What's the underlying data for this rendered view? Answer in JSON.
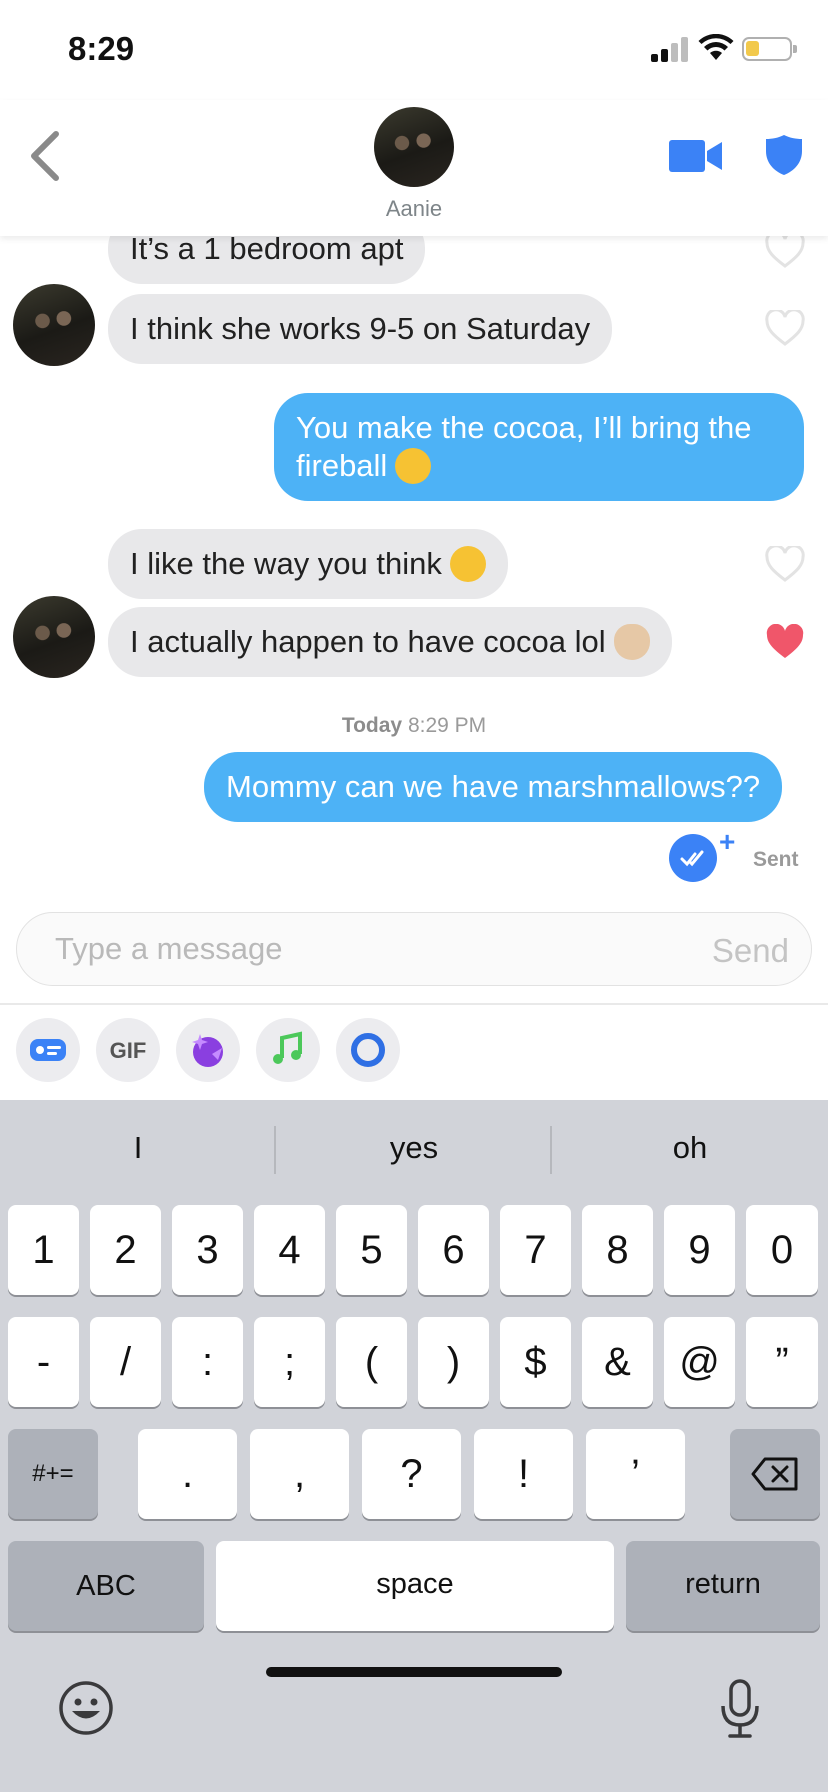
{
  "status_bar": {
    "time": "8:29",
    "battery_color": "#f2c94c"
  },
  "header": {
    "contact_name": "Aanie",
    "back_icon": "chevron-left-icon",
    "video_icon": "video-camera-icon",
    "safety_icon": "shield-icon",
    "accent": "#3b82f6"
  },
  "messages": [
    {
      "direction": "in",
      "text": "It’s a 1 bedroom apt",
      "liked": false
    },
    {
      "direction": "in",
      "text": "I think she works 9-5 on Saturday",
      "liked": false
    },
    {
      "direction": "out",
      "line1": "You make the cocoa, I’ll bring the",
      "line2": "fireball",
      "emoji": "kissing-face-emoji"
    },
    {
      "direction": "in",
      "text": "I like the way you think",
      "emoji": "kissing-face-emoji",
      "liked": false
    },
    {
      "direction": "in",
      "text": "I actually happen to have cocoa lol",
      "emoji": "ok-hand-emoji",
      "liked": true
    },
    {
      "direction": "out",
      "text": "Mommy can we have marshmallows??"
    }
  ],
  "timestamp": {
    "day": "Today",
    "time": "8:29 PM"
  },
  "read_receipt": {
    "plus": "+",
    "label": "Sent"
  },
  "composer": {
    "placeholder": "Type a message",
    "send_label": "Send"
  },
  "tools": [
    {
      "name": "contact-card-icon"
    },
    {
      "name": "gif-button",
      "label": "GIF"
    },
    {
      "name": "sticker-icon"
    },
    {
      "name": "music-icon"
    },
    {
      "name": "loop-icon"
    }
  ],
  "colors": {
    "incoming_bubble": "#e8e8ea",
    "outgoing_bubble": "#4db2f6",
    "heart_liked": "#f0566a",
    "heart_empty": "#e3e3e3"
  },
  "keyboard": {
    "suggestions": [
      "I",
      "yes",
      "oh"
    ],
    "row1": [
      "1",
      "2",
      "3",
      "4",
      "5",
      "6",
      "7",
      "8",
      "9",
      "0"
    ],
    "row2": [
      "-",
      "/",
      ":",
      ";",
      "(",
      ")",
      "$",
      "&",
      "@",
      "”"
    ],
    "row3_left": "#+=",
    "row3": [
      ".",
      ",",
      "?",
      "!",
      "’"
    ],
    "row4_left": "ABC",
    "space": "space",
    "return": "return"
  }
}
